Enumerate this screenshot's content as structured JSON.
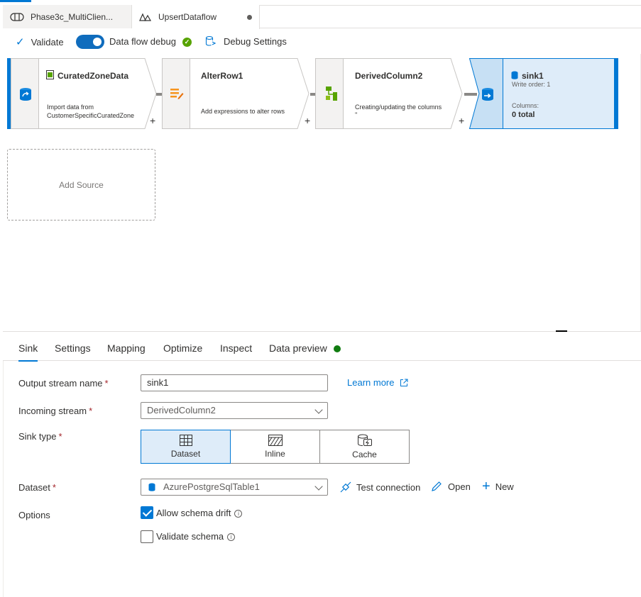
{
  "tabs": [
    {
      "label": "Phase3c_MultiClien...",
      "icon": "pipeline-icon"
    },
    {
      "label": "UpsertDataflow",
      "icon": "dataflow-icon",
      "unsaved": true
    }
  ],
  "toolbar": {
    "validate": "Validate",
    "debug_toggle": "Data flow debug",
    "debug_toggle_on": true,
    "debug_settings": "Debug Settings"
  },
  "nodes": {
    "source": {
      "title": "CuratedZoneData",
      "desc": "Import data from CustomerSpecificCuratedZone"
    },
    "alter": {
      "title": "AlterRow1",
      "desc": "Add expressions to alter rows"
    },
    "derived": {
      "title": "DerivedColumn2",
      "desc": "Creating/updating the columns",
      "desc2": "''"
    },
    "sink": {
      "title": "sink1",
      "write_order": "Write order: 1",
      "columns_label": "Columns:",
      "columns_value": "0 total"
    },
    "plus": "+"
  },
  "add_source": "Add Source",
  "panel_tabs": [
    "Sink",
    "Settings",
    "Mapping",
    "Optimize",
    "Inspect",
    "Data preview"
  ],
  "form": {
    "output_stream_label": "Output stream name",
    "output_stream_value": "sink1",
    "learn_more": "Learn more",
    "incoming_stream_label": "Incoming stream",
    "incoming_stream_value": "DerivedColumn2",
    "sink_type_label": "Sink type",
    "sink_types": [
      "Dataset",
      "Inline",
      "Cache"
    ],
    "sink_type_selected": "Dataset",
    "dataset_label": "Dataset",
    "dataset_value": "AzurePostgreSqlTable1",
    "test_connection": "Test connection",
    "open": "Open",
    "new": "New",
    "options_label": "Options",
    "allow_schema_drift": "Allow schema drift",
    "allow_schema_drift_checked": true,
    "validate_schema": "Validate schema",
    "validate_schema_checked": false,
    "required_mark": "*"
  },
  "colors": {
    "accent": "#0078d4",
    "success": "#57a300",
    "sink_bg": "#deecf9"
  }
}
